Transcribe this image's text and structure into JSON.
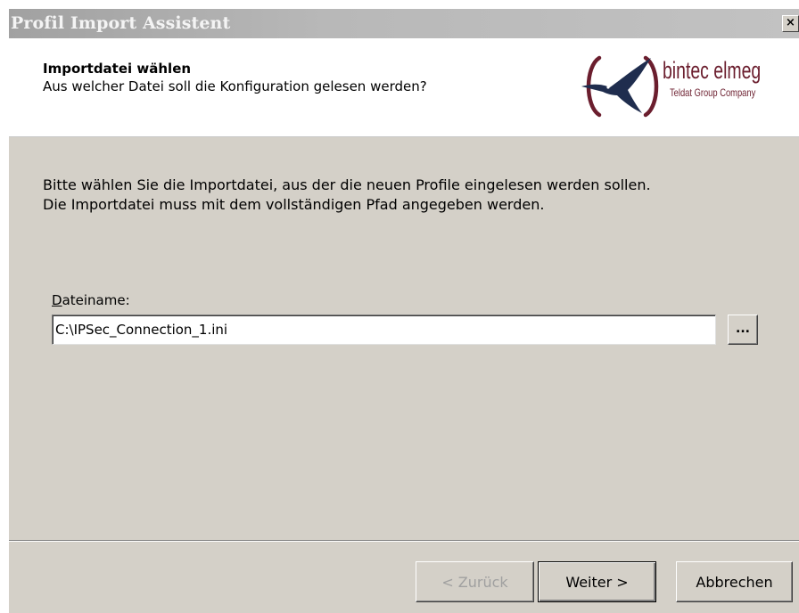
{
  "window": {
    "title": "Profil Import Assistent",
    "close_glyph": "×"
  },
  "header": {
    "title": "Importdatei wählen",
    "subtitle": "Aus welcher Datei soll die Konfiguration gelesen werden?",
    "logo": {
      "name": "bintec elmeg",
      "tagline": "Teldat Group Company",
      "icon": "bird-in-brackets-logo",
      "color": "#6b1e2e",
      "bird_color": "#1f2d4e"
    }
  },
  "content": {
    "description_line1": "Bitte wählen Sie die Importdatei, aus der die neuen Profile eingelesen werden sollen.",
    "description_line2": "Die Importdatei muss mit dem vollständigen Pfad angegeben werden.",
    "file_label_mnemonic": "D",
    "file_label_rest": "ateiname:",
    "file_value": "C:\\IPSec_Connection_1.ini",
    "browse_label": "..."
  },
  "buttons": {
    "back": "< Zurück",
    "next": "Weiter >",
    "cancel": "Abbrechen"
  }
}
